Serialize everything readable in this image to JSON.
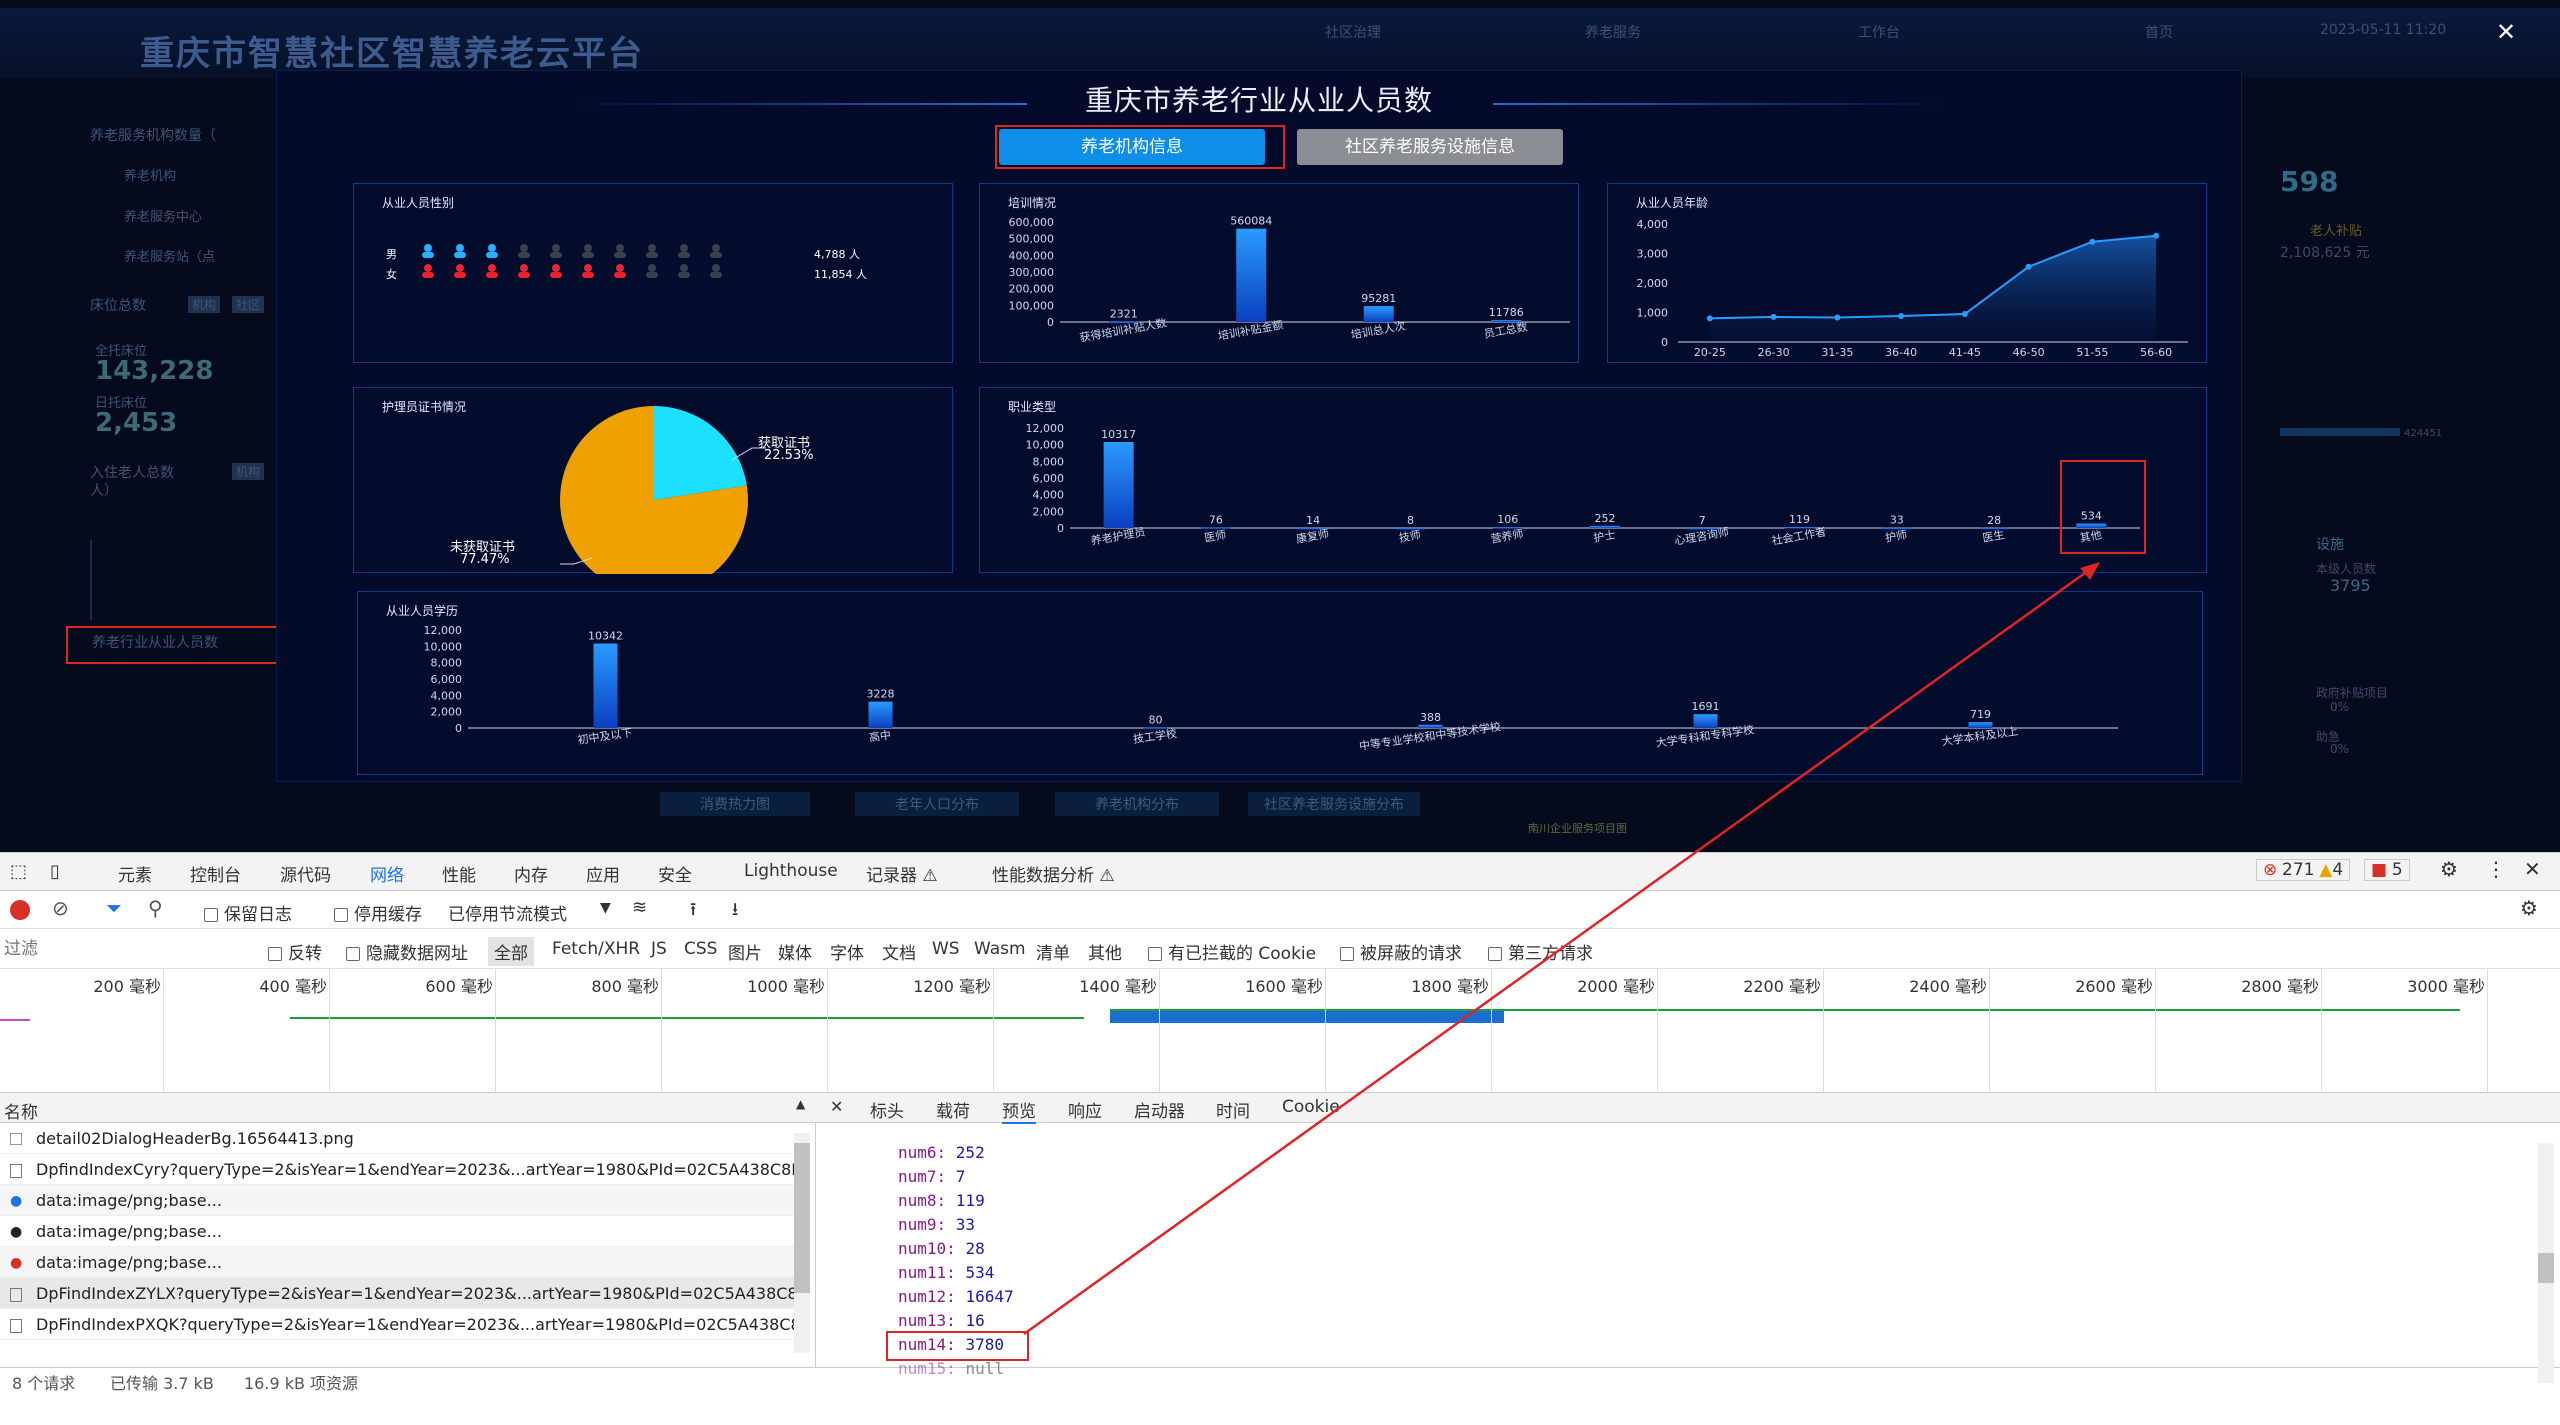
{
  "app": {
    "title": "重庆市智慧社区智慧养老云平台",
    "nav": [
      "社区治理",
      "养老服务",
      "工作台",
      "首页",
      "2023-05-11 11:20"
    ],
    "left": {
      "section1": "养老服务机构数量（",
      "items": [
        "养老机构",
        "养老服务中心",
        "养老服务站（点"
      ],
      "section2": "床位总数",
      "tag1": "机构",
      "tag2": "社区",
      "bed1_label": "全托床位",
      "bed1_value": "143,228",
      "bed2_label": "日托床位",
      "bed2_value": "2,453",
      "section3": "入住老人总数",
      "section3b": "人）",
      "tag3": "机构",
      "highlight": "养老行业从业人员数"
    },
    "right": {
      "big": "598",
      "sub": "老人补贴",
      "amount": "2,108,625 元",
      "num": "424451",
      "label1": "设施",
      "label2": "本级人员数",
      "v1": "3795",
      "label3": "政府补贴项目",
      "v2": "0%",
      "label4": "助急",
      "v3": "0%"
    },
    "bottom_tabs": [
      "消费热力图",
      "老年人口分布",
      "养老机构分布",
      "社区养老服务设施分布"
    ],
    "map_label": "南川企业服务项目图"
  },
  "modal": {
    "title": "重庆市养老行业从业人员数",
    "btn_active": "养老机构信息",
    "btn_inactive": "社区养老服务设施信息",
    "close": "✕",
    "gender": {
      "title": "从业人员性别",
      "male_label": "男",
      "female_label": "女",
      "male_value": "4,788 人",
      "female_value": "11,854 人",
      "male_share": 0.2877,
      "female_share": 0.7123
    },
    "training": {
      "title": "培训情况",
      "yticks": [
        "600,000",
        "500,000",
        "400,000",
        "300,000",
        "200,000",
        "100,000",
        "0"
      ]
    },
    "age": {
      "title": "从业人员年龄",
      "yticks": [
        "4,000",
        "3,000",
        "2,000",
        "1,000",
        "0"
      ]
    },
    "cert": {
      "title": "护理员证书情况",
      "got_label": "获取证书",
      "got_pct": "22.53%",
      "not_label": "未获取证书",
      "not_pct": "77.47%"
    },
    "job": {
      "title": "职业类型",
      "yticks": [
        "12,000",
        "10,000",
        "8,000",
        "6,000",
        "4,000",
        "2,000",
        "0"
      ]
    },
    "edu": {
      "title": "从业人员学历",
      "yticks": [
        "12,000",
        "10,000",
        "8,000",
        "6,000",
        "4,000",
        "2,000",
        "0"
      ]
    }
  },
  "chart_data": [
    {
      "type": "bar",
      "categories": [
        "获得培训补贴人数",
        "培训补贴金额",
        "培训总人次",
        "员工总数"
      ],
      "values": [
        2321,
        560084,
        95281,
        11786
      ],
      "ylim": [
        0,
        600000
      ]
    },
    {
      "type": "area",
      "categories": [
        "20-25",
        "26-30",
        "31-35",
        "36-40",
        "41-45",
        "46-50",
        "51-55",
        "56-60"
      ],
      "values": [
        800,
        850,
        830,
        880,
        950,
        2550,
        3400,
        3600
      ],
      "ylim": [
        0,
        4000
      ]
    },
    {
      "type": "pie",
      "categories": [
        "获取证书",
        "未获取证书"
      ],
      "values": [
        22.53,
        77.47
      ]
    },
    {
      "type": "bar",
      "categories": [
        "养老护理员",
        "医师",
        "康复师",
        "技师",
        "营养师",
        "护士",
        "心理咨询师",
        "社会工作者",
        "护师",
        "医生",
        "其他"
      ],
      "values": [
        10317,
        76,
        14,
        8,
        106,
        252,
        7,
        119,
        33,
        28,
        534
      ],
      "ylim": [
        0,
        12000
      ]
    },
    {
      "type": "bar",
      "categories": [
        "初中及以下",
        "高中",
        "技工学校",
        "中等专业学校和中等技术学校",
        "大学专科和专科学校",
        "大学本科及以上"
      ],
      "values": [
        10342,
        3228,
        80,
        388,
        1691,
        719
      ],
      "ylim": [
        0,
        12000
      ]
    }
  ],
  "devtools": {
    "tabs": [
      "元素",
      "控制台",
      "源代码",
      "网络",
      "性能",
      "内存",
      "应用",
      "安全",
      "Lighthouse",
      "记录器 ⚠",
      "性能数据分析 ⚠"
    ],
    "errors": "271",
    "warnings": "4",
    "issues": "5",
    "toolbar": {
      "preserve_log": "保留日志",
      "disable_cache": "停用缓存",
      "throttle": "已停用节流模式"
    },
    "filter": {
      "placeholder": "过滤",
      "invert": "反转",
      "hide_data": "隐藏数据网址",
      "types": [
        "全部",
        "Fetch/XHR",
        "JS",
        "CSS",
        "图片",
        "媒体",
        "字体",
        "文档",
        "WS",
        "Wasm",
        "清单",
        "其他"
      ],
      "blocked_cookies": "有已拦截的 Cookie",
      "blocked_requests": "被屏蔽的请求",
      "third_party": "第三方请求"
    },
    "timeline_ticks": [
      "200 毫秒",
      "400 毫秒",
      "600 毫秒",
      "800 毫秒",
      "1000 毫秒",
      "1200 毫秒",
      "1400 毫秒",
      "1600 毫秒",
      "1800 毫秒",
      "2000 毫秒",
      "2200 毫秒",
      "2400 毫秒",
      "2600 毫秒",
      "2800 毫秒",
      "3000 毫秒"
    ],
    "name_header": "名称",
    "requests": [
      "detail02DialogHeaderBg.16564413.png",
      "DpfindIndexCyry?queryType=2&isYear=1&endYear=2023&...artYear=1980&PId=02C5A438C8D",
      "data:image/png;base...",
      "data:image/png;base...",
      "data:image/png;base...",
      "DpFindIndexZYLX?queryType=2&isYear=1&endYear=2023&...artYear=1980&PId=02C5A438C8.",
      "DpFindIndexPXQK?queryType=2&isYear=1&endYear=2023&...artYear=1980&PId=02C5A438C8"
    ],
    "detail_tabs": [
      "标头",
      "载荷",
      "预览",
      "响应",
      "启动器",
      "时间",
      "Cookie"
    ],
    "preview": [
      {
        "key": "num6",
        "val": "252"
      },
      {
        "key": "num7",
        "val": "7"
      },
      {
        "key": "num8",
        "val": "119"
      },
      {
        "key": "num9",
        "val": "33"
      },
      {
        "key": "num10",
        "val": "28"
      },
      {
        "key": "num11",
        "val": "534"
      },
      {
        "key": "num12",
        "val": "16647"
      },
      {
        "key": "num13",
        "val": "16"
      },
      {
        "key": "num14",
        "val": "3780"
      },
      {
        "key": "num15",
        "val": "null"
      }
    ],
    "status": {
      "requests": "8 个请求",
      "transferred": "已传输 3.7 kB",
      "resources": "16.9 kB 项资源"
    }
  }
}
